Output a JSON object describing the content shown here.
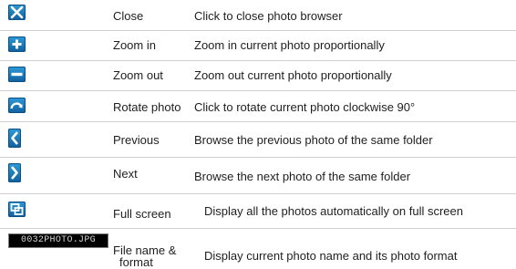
{
  "rows": [
    {
      "icon": "close-icon",
      "name": "Close",
      "description": "Click to close photo browser"
    },
    {
      "icon": "zoom-in-icon",
      "name": "Zoom in",
      "description": "Zoom in current photo proportionally"
    },
    {
      "icon": "zoom-out-icon",
      "name": "Zoom out",
      "description": "Zoom out current photo proportionally"
    },
    {
      "icon": "rotate-icon",
      "name": "Rotate photo",
      "description": "Click to rotate current photo clockwise 90°"
    },
    {
      "icon": "previous-icon",
      "name": "Previous",
      "description": "Browse the previous photo of the same folder"
    },
    {
      "icon": "next-icon",
      "name": "Next",
      "description": "Browse the next photo of the same folder"
    },
    {
      "icon": "full-screen-icon",
      "name": "Full screen",
      "description": "Display all the photos automatically on full screen"
    },
    {
      "icon": "file-name-display",
      "file_label": "0032PHOTO.JPG",
      "name_line1": "File name &",
      "name_line2": "format",
      "description": "Display current photo name and its photo format"
    }
  ],
  "colors": {
    "icon_blue": "#1a7cc0",
    "separator": "#cfcfcf"
  }
}
